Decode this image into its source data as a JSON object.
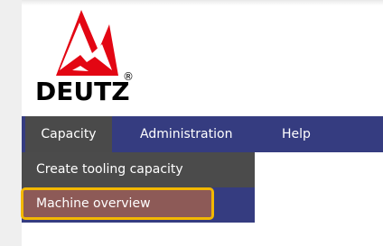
{
  "logo": {
    "brand": "DEUTZ",
    "registered": "®"
  },
  "nav": {
    "items": [
      {
        "label": "Capacity"
      },
      {
        "label": "Administration"
      },
      {
        "label": "Help"
      }
    ]
  },
  "dropdown": {
    "items": [
      {
        "label": "Create tooling capacity"
      },
      {
        "label": "Machine overview"
      }
    ]
  },
  "colors": {
    "navbar": "#353c80",
    "active_menu": "#4a4a4a",
    "logo_red": "#e30613",
    "highlight_border": "#f3b800",
    "highlight_fill": "#8d5a57"
  },
  "icons": {
    "logo_mark": "deutz-logo-icon"
  }
}
